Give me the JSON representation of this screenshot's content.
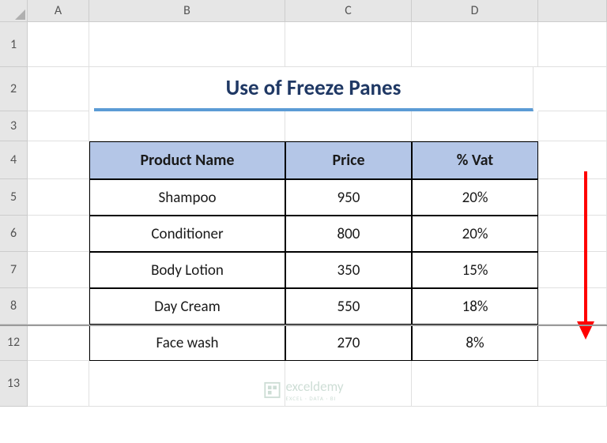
{
  "columns": [
    "A",
    "B",
    "C",
    "D"
  ],
  "rows": [
    "1",
    "2",
    "3",
    "4",
    "5",
    "6",
    "7",
    "8",
    "12",
    "13"
  ],
  "title": "Use of Freeze Panes",
  "table": {
    "headers": [
      "Product Name",
      "Price",
      "% Vat"
    ],
    "data": [
      {
        "product": "Shampoo",
        "price": "950",
        "vat": "20%"
      },
      {
        "product": "Conditioner",
        "price": "800",
        "vat": "20%"
      },
      {
        "product": "Body Lotion",
        "price": "350",
        "vat": "15%"
      },
      {
        "product": "Day Cream",
        "price": "550",
        "vat": "18%"
      },
      {
        "product": "Face wash",
        "price": "270",
        "vat": "8%"
      }
    ]
  },
  "watermark": {
    "name": "exceldemy",
    "tagline": "EXCEL · DATA · BI"
  }
}
